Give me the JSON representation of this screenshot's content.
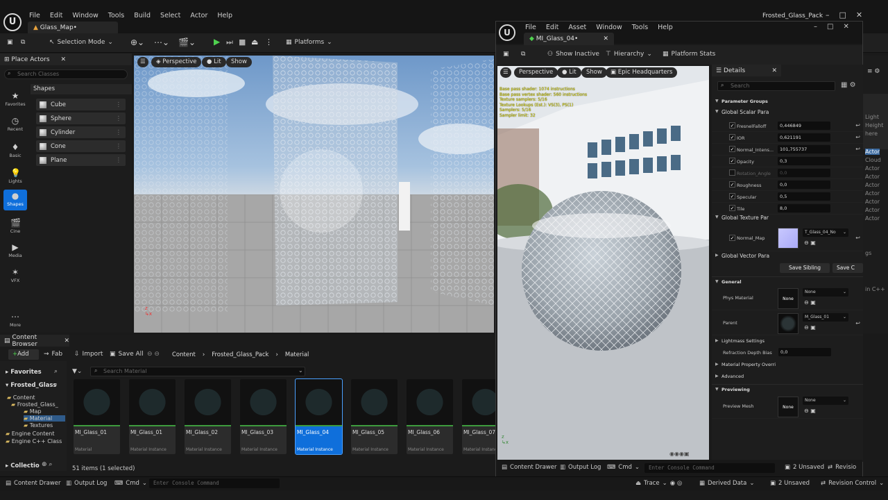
{
  "main": {
    "menu": [
      "File",
      "Edit",
      "Window",
      "Tools",
      "Build",
      "Select",
      "Actor",
      "Help"
    ],
    "title": "Frosted_Glass_Pack",
    "level_tab": "Glass_Map•",
    "selection_mode": "Selection Mode",
    "platforms": "Platforms",
    "place_actors": {
      "title": "Place Actors",
      "search_placeholder": "Search Classes",
      "section": "Shapes",
      "categories": [
        "Favorites",
        "Recent",
        "Basic",
        "Lights",
        "Shapes",
        "Cine",
        "Media",
        "VFX",
        "More"
      ],
      "shapes": [
        "Cube",
        "Sphere",
        "Cylinder",
        "Cone",
        "Plane"
      ]
    },
    "viewport": {
      "perspective": "Perspective",
      "lit": "Lit",
      "show": "Show"
    },
    "content_browser": {
      "title": "Content Browser",
      "add": "Add",
      "fab": "Fab",
      "import": "Import",
      "save_all": "Save All",
      "breadcrumb": [
        "Content",
        "Frosted_Glass_Pack",
        "Material"
      ],
      "favorites": "Favorites",
      "root": "Frosted_Glass",
      "tree": [
        "Content",
        "Frosted_Glass_",
        "Map",
        "Material",
        "Textures",
        "Engine Content",
        "Engine C++ Class"
      ],
      "search_placeholder": "Search Material",
      "collections": "Collectio",
      "status": "51 items (1 selected)",
      "assets": [
        {
          "name": "MI_Glass_01",
          "type": "Material"
        },
        {
          "name": "MI_Glass_01",
          "type": "Material Instance"
        },
        {
          "name": "MI_Glass_02",
          "type": "Material Instance"
        },
        {
          "name": "MI_Glass_03",
          "type": "Material Instance"
        },
        {
          "name": "MI_Glass_04",
          "type": "Material Instance"
        },
        {
          "name": "MI_Glass_05",
          "type": "Material Instance"
        },
        {
          "name": "MI_Glass_06",
          "type": "Material Instance"
        },
        {
          "name": "MI_Glass_07",
          "type": "Material Instance"
        }
      ]
    },
    "statusbar": {
      "content_drawer": "Content Drawer",
      "output_log": "Output Log",
      "cmd": "Cmd",
      "console_placeholder": "Enter Console Command",
      "trace": "Trace",
      "derived_data": "Derived Data",
      "unsaved": "2 Unsaved",
      "revision_control": "Revision Control"
    },
    "right_peek": [
      "Light",
      "Height",
      "here",
      "Actor",
      "Cloud",
      "Actor",
      "Actor",
      "Actor",
      "Actor",
      "Actor",
      "Actor",
      "Actor",
      "gs",
      "in C++"
    ]
  },
  "material_editor": {
    "menu": [
      "File",
      "Edit",
      "Asset",
      "Window",
      "Tools",
      "Help"
    ],
    "tab": "MI_Glass_04•",
    "toolbar": {
      "show_inactive": "Show Inactive",
      "hierarchy": "Hierarchy",
      "platform_stats": "Platform Stats"
    },
    "viewport": {
      "perspective": "Perspective",
      "lit": "Lit",
      "show": "Show",
      "hdri": "Epic Headquarters",
      "stats": [
        "Base pass shader: 1074 instructions",
        "Base pass vertex shader: 560 instructions",
        "Texture samplers: 5/16",
        "Texture Lookups (Est.): VS(3), PS(1)",
        "Samplers: 5/16",
        "Sampler limit: 32"
      ]
    },
    "details": {
      "title": "Details",
      "search_placeholder": "Search",
      "parameter_groups": "Parameter Groups",
      "global_scalar": "Global Scalar Para",
      "scalars": [
        {
          "name": "FresnelFalloff",
          "value": "0,446849",
          "checked": true
        },
        {
          "name": "IOR",
          "value": "0,621191",
          "checked": true
        },
        {
          "name": "Normal_Intens...",
          "value": "101,755737",
          "checked": true
        },
        {
          "name": "Opacity",
          "value": "0,3",
          "checked": true
        },
        {
          "name": "Rotation_Angle",
          "value": "0,0",
          "checked": false
        },
        {
          "name": "Roughness",
          "value": "0,0",
          "checked": true
        },
        {
          "name": "Specular",
          "value": "0,5",
          "checked": true
        },
        {
          "name": "Tile",
          "value": "8,0",
          "checked": true
        }
      ],
      "global_texture": "Global Texture Par",
      "normal_map": "Normal_Map",
      "normal_map_value": "T_Glass_04_No",
      "global_vector": "Global Vector Para",
      "save_sibling": "Save Sibling",
      "save_child": "Save C",
      "general": "General",
      "phys_material": "Phys Material",
      "phys_value": "None",
      "none_label": "None",
      "parent": "Parent",
      "parent_value": "M_Glass_01",
      "lightmass": "Lightmass Settings",
      "refraction": "Refraction Depth Bias",
      "refraction_value": "0,0",
      "material_override": "Material Property Overri",
      "advanced": "Advanced",
      "previewing": "Previewing",
      "preview_mesh": "Preview Mesh",
      "preview_value": "None"
    },
    "statusbar": {
      "content_drawer": "Content Drawer",
      "output_log": "Output Log",
      "cmd": "Cmd",
      "console_placeholder": "Enter Console Command",
      "unsaved": "2 Unsaved",
      "revision": "Revisio"
    }
  }
}
